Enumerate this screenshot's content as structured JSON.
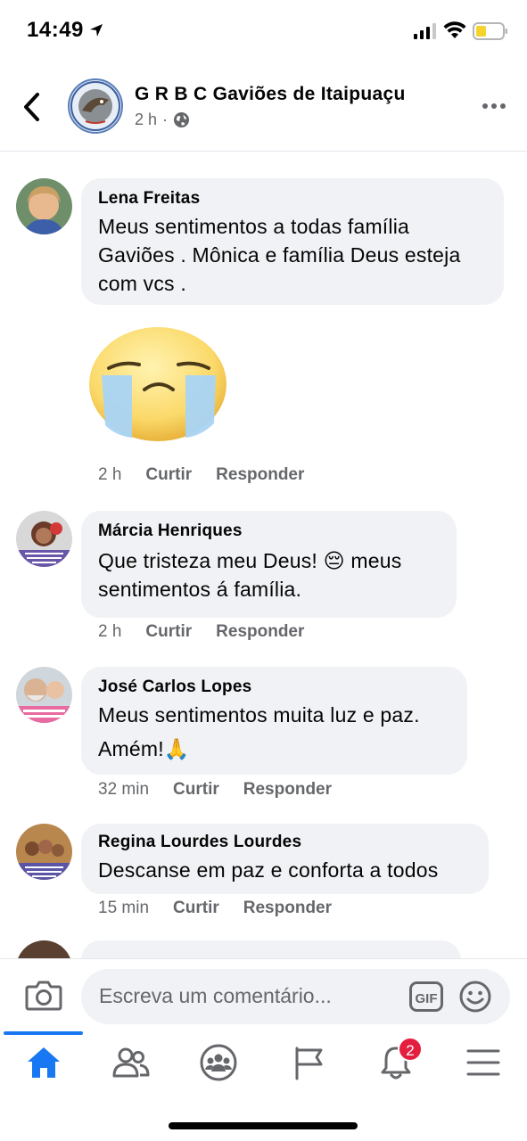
{
  "status_bar": {
    "time": "14:49"
  },
  "header": {
    "title": "G R B C Gaviões de Itaipuaçu",
    "time_ago": "2 h",
    "privacy_icon": "globe-icon"
  },
  "comments": [
    {
      "author": "Lena Freitas",
      "lines": [
        "Meus sentimentos a todas família",
        "Gaviões . Mônica e família Deus esteja",
        "com vcs ."
      ],
      "sticker": "crying-face-sticker",
      "time": "2 h",
      "like_label": "Curtir",
      "reply_label": "Responder"
    },
    {
      "author": "Márcia Henriques",
      "lines": [
        "Que tristeza meu Deus! 😔  meus",
        "sentimentos á família."
      ],
      "time": "2 h",
      "like_label": "Curtir",
      "reply_label": "Responder"
    },
    {
      "author": "José Carlos Lopes",
      "lines": [
        "Meus sentimentos muita luz e paz.",
        "Amém!🙏"
      ],
      "time": "32 min",
      "like_label": "Curtir",
      "reply_label": "Responder"
    },
    {
      "author": "Regina Lourdes Lourdes",
      "lines": [
        "Descanse em paz e conforta a todos"
      ],
      "time": "15 min",
      "like_label": "Curtir",
      "reply_label": "Responder"
    }
  ],
  "composer": {
    "placeholder": "Escreva um comentário...",
    "gif_label": "GIF"
  },
  "tabbar": {
    "tabs": [
      "home-icon",
      "friends-icon",
      "groups-icon",
      "pages-flag-icon",
      "notifications-bell-icon",
      "menu-icon"
    ],
    "notification_count": "2"
  },
  "colors": {
    "accent": "#1877f2",
    "bubble": "#f0f2f5",
    "badge": "#e41e3f",
    "meta_text": "#65676b"
  }
}
